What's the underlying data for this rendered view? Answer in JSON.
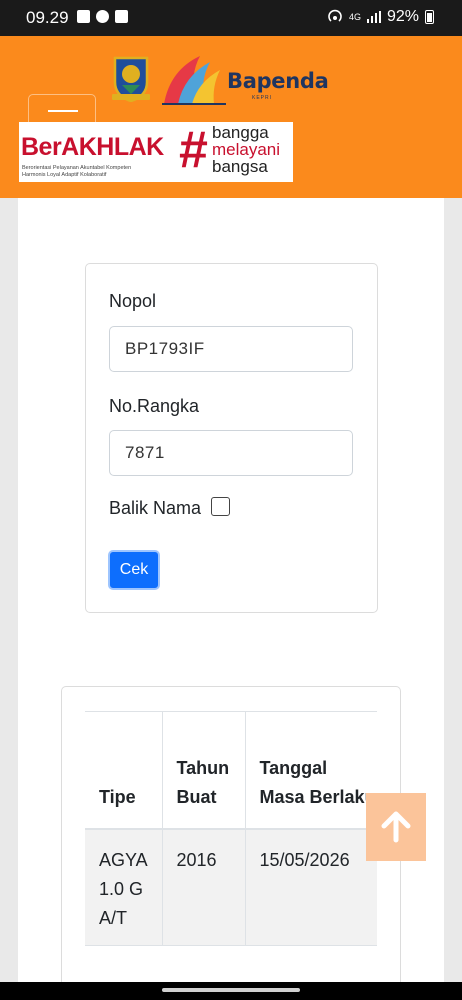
{
  "status_bar": {
    "time": "09.29",
    "network": "4G",
    "battery": "92%"
  },
  "header": {
    "bapenda_name": "Bapenda",
    "bapenda_sub": "KEPRI",
    "berakhlak": {
      "title": "BerAKHLAK",
      "sub_line1": "Berorientasi Pelayanan Akuntabel Kompeten",
      "sub_line2": "Harmonis Loyal Adaptif Kolaboratif",
      "hash": "#",
      "slogan": [
        "bangga",
        "melayani",
        "bangsa"
      ]
    },
    "colors": {
      "header_bg": "#fb8a1c",
      "brand_red": "#c8102e",
      "brand_blue": "#1f3560"
    }
  },
  "form": {
    "nopol_label": "Nopol",
    "nopol_value": "BP1793IF",
    "rangka_label": "No.Rangka",
    "rangka_value": "7871",
    "balik_nama_label": "Balik Nama",
    "balik_nama_checked": false,
    "submit_label": "Cek"
  },
  "result_table": {
    "headers": [
      "Tipe",
      "Tahun Buat",
      "Tanggal Masa Berlaku"
    ],
    "rows": [
      [
        "AGYA 1.0 G A/T",
        "2016",
        "15/05/2026"
      ]
    ]
  },
  "icons": {
    "scroll_top": "arrow-up-icon",
    "menu": "hamburger-icon"
  }
}
